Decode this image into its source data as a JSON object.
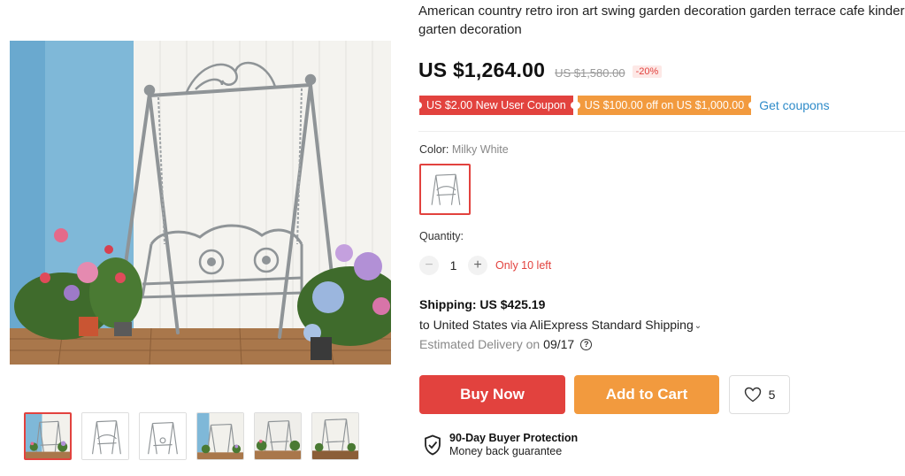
{
  "product": {
    "title": "American country retro iron art swing garden decoration garden terrace cafe kinder garten decoration",
    "price": "US $1,264.00",
    "original_price": "US $1,580.00",
    "discount": "-20%"
  },
  "coupons": {
    "items": [
      {
        "label": "US $2.00 New User Coupon",
        "color": "#e2423e"
      },
      {
        "label": "US $100.00 off on US $1,000.00",
        "color": "#f29a3e"
      }
    ],
    "get_label": "Get coupons"
  },
  "color": {
    "label": "Color:",
    "selected": "Milky White"
  },
  "quantity": {
    "label": "Quantity:",
    "minus": "−",
    "value": "1",
    "plus": "+",
    "note": "Only 10 left"
  },
  "shipping": {
    "title": "Shipping: US $425.19",
    "line": "to United States via AliExpress Standard Shipping",
    "chevron": "⌄",
    "delivery_label": "Estimated Delivery on",
    "delivery_date": "09/17",
    "help": "?"
  },
  "actions": {
    "buy_now": "Buy Now",
    "add_to_cart": "Add to Cart",
    "wishlist_count": "5"
  },
  "protection": {
    "title": "90-Day Buyer Protection",
    "subtitle": "Money back guarantee"
  },
  "gallery": {
    "thumbnail_count": 6,
    "active_index": 0
  },
  "colors": {
    "accent_red": "#e2423e",
    "accent_orange": "#f29a3e",
    "link_blue": "#2e8bc9"
  }
}
